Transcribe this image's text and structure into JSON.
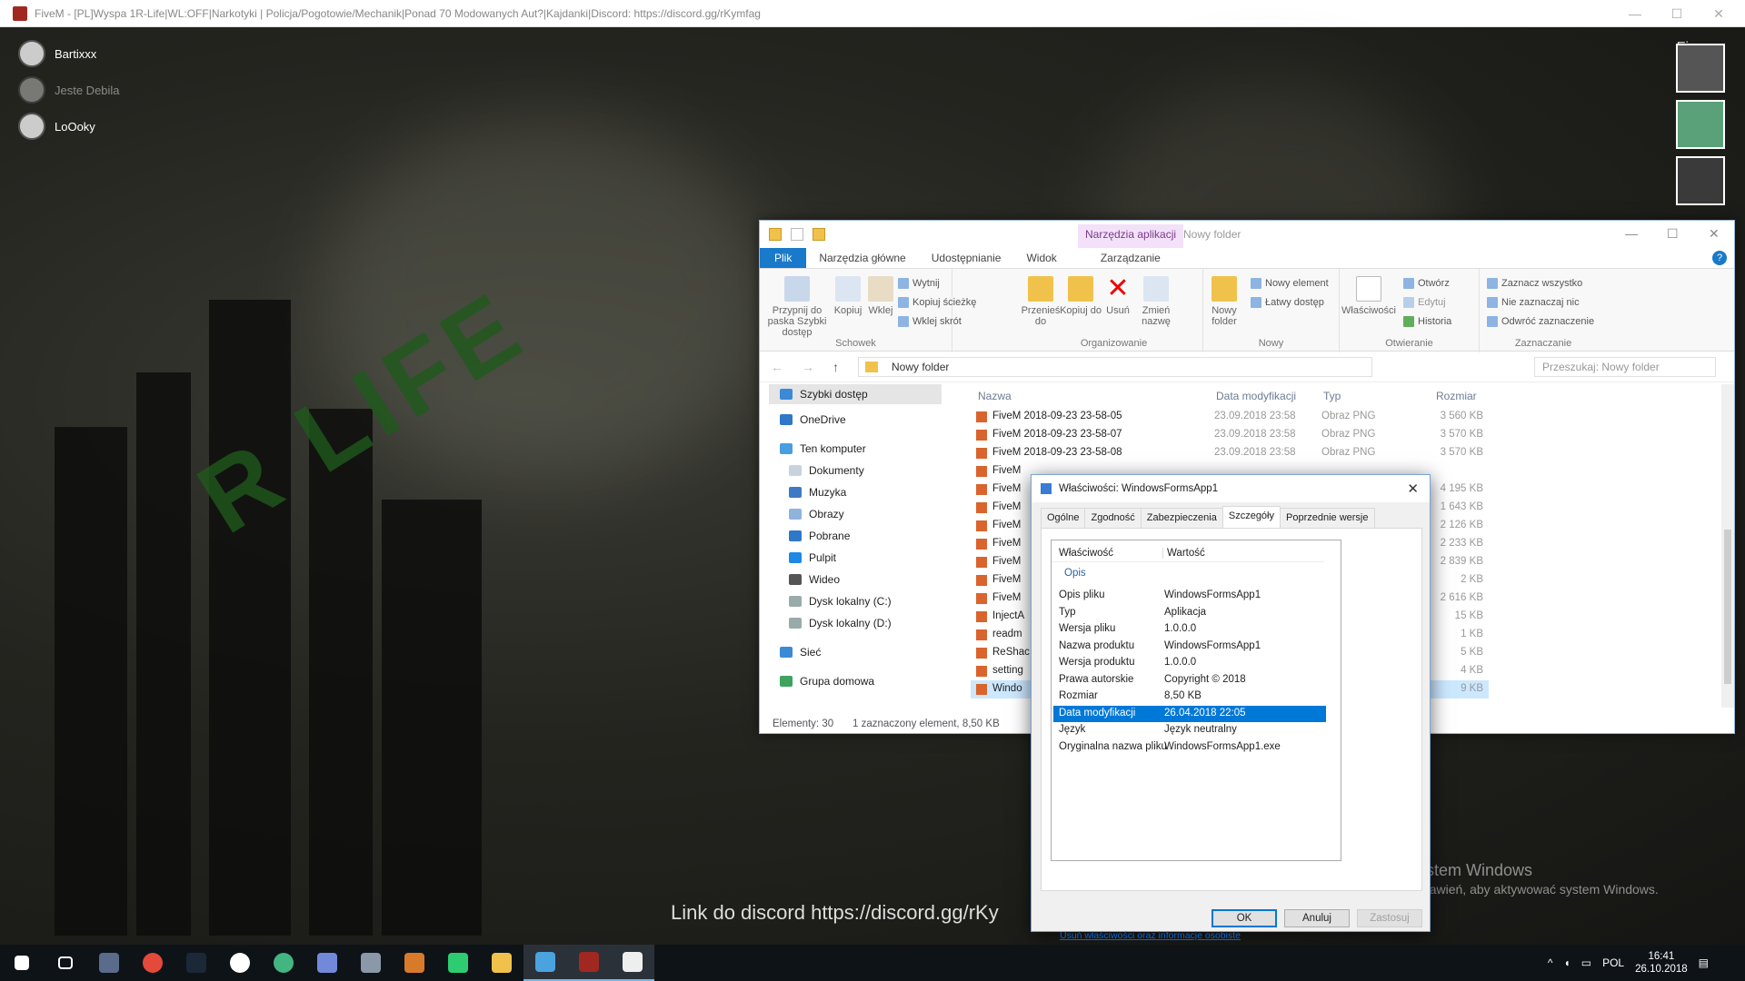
{
  "window": {
    "title": "FiveM - [PL]Wyspa 1R-Life|WL:OFF|Narkotyki | Policja/Pogotowie/Mechanik|Ponad 70 Modowanych Aut?|Kajdanki|Discord: https://discord.gg/rKymfag"
  },
  "voice": {
    "users": [
      {
        "name": "Bartixxx",
        "state": "active"
      },
      {
        "name": "Jeste Debila",
        "state": "dim"
      },
      {
        "name": "LoOoky",
        "state": "active"
      }
    ]
  },
  "overlay": {
    "fi_label": "Fi",
    "subtitle": "Link do discord https://discord.gg/rKy"
  },
  "activation": {
    "line1": "Aktywuj system Windows",
    "line2": "Przejdź do ustawień, aby aktywować system Windows."
  },
  "explorer": {
    "tool_tab": "Narzędzia aplikacji",
    "folder_title": "Nowy folder",
    "tabs": [
      "Plik",
      "Narzędzia główne",
      "Udostępnianie",
      "Widok",
      "Zarządzanie"
    ],
    "ribbon": {
      "clipboard": {
        "group": "Schowek",
        "pin": "Przypnij do paska Szybki dostęp",
        "copy": "Kopiuj",
        "paste": "Wklej",
        "cut": "Wytnij",
        "copy_path": "Kopiuj ścieżkę",
        "paste_shortcut": "Wklej skrót"
      },
      "organize": {
        "group": "Organizowanie",
        "move": "Przenieś do",
        "copy_to": "Kopiuj do",
        "delete": "Usuń",
        "rename": "Zmień nazwę"
      },
      "new": {
        "group": "Nowy",
        "new_folder": "Nowy folder",
        "new_item": "Nowy element",
        "easy_access": "Łatwy dostęp"
      },
      "open": {
        "group": "Otwieranie",
        "properties": "Właściwości",
        "open": "Otwórz",
        "edit": "Edytuj",
        "history": "Historia"
      },
      "select": {
        "group": "Zaznaczanie",
        "select_all": "Zaznacz wszystko",
        "select_none": "Nie zaznaczaj nic",
        "invert": "Odwróć zaznaczenie"
      }
    },
    "address": "Nowy folder",
    "search_placeholder": "Przeszukaj: Nowy folder",
    "nav": {
      "quick_access": "Szybki dostęp",
      "onedrive": "OneDrive",
      "this_pc": "Ten komputer",
      "documents": "Dokumenty",
      "music": "Muzyka",
      "pictures": "Obrazy",
      "downloads": "Pobrane",
      "desktop": "Pulpit",
      "video": "Wideo",
      "disk_c": "Dysk lokalny (C:)",
      "disk_d": "Dysk lokalny (D:)",
      "network": "Sieć",
      "homegroup": "Grupa domowa"
    },
    "columns": {
      "name": "Nazwa",
      "date": "Data modyfikacji",
      "type": "Typ",
      "size": "Rozmiar"
    },
    "files": [
      {
        "name": "FiveM 2018-09-23 23-58-05",
        "date": "23.09.2018 23:58",
        "type": "Obraz PNG",
        "size": "3 560 KB"
      },
      {
        "name": "FiveM 2018-09-23 23-58-07",
        "date": "23.09.2018 23:58",
        "type": "Obraz PNG",
        "size": "3 570 KB"
      },
      {
        "name": "FiveM 2018-09-23 23-58-08",
        "date": "23.09.2018 23:58",
        "type": "Obraz PNG",
        "size": "3 570 KB"
      },
      {
        "name": "FiveM",
        "date": "",
        "type": "",
        "size": ""
      },
      {
        "name": "FiveM",
        "date": "",
        "type": "",
        "size": "4 195 KB"
      },
      {
        "name": "FiveM",
        "date": "",
        "type": "",
        "size": "1 643 KB"
      },
      {
        "name": "FiveM",
        "date": "",
        "type": "",
        "size": "2 126 KB"
      },
      {
        "name": "FiveM",
        "date": "",
        "type": "",
        "size": "2 233 KB"
      },
      {
        "name": "FiveM",
        "date": "",
        "type": "",
        "size": "2 839 KB"
      },
      {
        "name": "FiveM",
        "date": "",
        "type": "",
        "size": "2 KB"
      },
      {
        "name": "FiveM",
        "date": "",
        "type": "",
        "size": "2 616 KB"
      },
      {
        "name": "InjectA",
        "date": "",
        "type": "",
        "size": "15 KB"
      },
      {
        "name": "readm",
        "date": "",
        "type": "",
        "size": "1 KB"
      },
      {
        "name": "ReShac",
        "date": "",
        "type": "",
        "size": "5 KB"
      },
      {
        "name": "setting",
        "date": "",
        "type": "",
        "size": "4 KB"
      },
      {
        "name": "Windo",
        "date": "",
        "type": "",
        "size": "9 KB"
      }
    ],
    "status": {
      "count": "Elementy: 30",
      "selected": "1 zaznaczony element, 8,50 KB"
    }
  },
  "props": {
    "title": "Właściwości: WindowsFormsApp1",
    "tabs": [
      "Ogólne",
      "Zgodność",
      "Zabezpieczenia",
      "Szczegóły",
      "Poprzednie wersje"
    ],
    "header": {
      "k": "Właściwość",
      "v": "Wartość"
    },
    "group": "Opis",
    "rows": [
      {
        "k": "Opis pliku",
        "v": "WindowsFormsApp1"
      },
      {
        "k": "Typ",
        "v": "Aplikacja"
      },
      {
        "k": "Wersja pliku",
        "v": "1.0.0.0"
      },
      {
        "k": "Nazwa produktu",
        "v": "WindowsFormsApp1"
      },
      {
        "k": "Wersja produktu",
        "v": "1.0.0.0"
      },
      {
        "k": "Prawa autorskie",
        "v": "Copyright © 2018"
      },
      {
        "k": "Rozmiar",
        "v": "8,50 KB"
      },
      {
        "k": "Data modyfikacji",
        "v": "26.04.2018 22:05"
      },
      {
        "k": "Język",
        "v": "Język neutralny"
      },
      {
        "k": "Oryginalna nazwa pliku",
        "v": "WindowsFormsApp1.exe"
      }
    ],
    "link": "Usuń właściwości oraz informacje osobiste",
    "ok": "OK",
    "cancel": "Anuluj",
    "apply": "Zastosuj"
  },
  "taskbar": {
    "lang": "POL",
    "time": "16:41",
    "date": "26.10.2018"
  }
}
